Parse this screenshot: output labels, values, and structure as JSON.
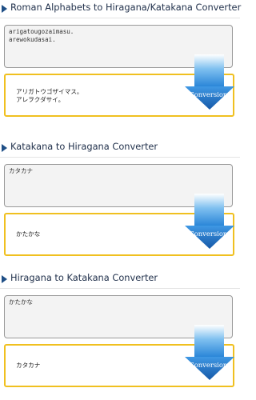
{
  "converters": [
    {
      "title": "Roman Alphabets to Hiragana/Katakana Converter",
      "input_value": "arigatougozaimasu.\narewokudasai.",
      "output_value": "アリガトウゴザイマス。\nアレヲクダサイ。",
      "button_label": "Conversion!"
    },
    {
      "title": "Katakana to Hiragana Converter",
      "input_value": "カタカナ",
      "output_value": "かたかな",
      "button_label": "Conversion!"
    },
    {
      "title": "Hiragana to Katakana Converter",
      "input_value": "かたかな",
      "output_value": "カタカナ",
      "button_label": "Conversion!"
    }
  ],
  "icons": {
    "section_marker": "triangle-right-icon",
    "convert_arrow": "down-arrow-icon"
  },
  "colors": {
    "accent_blue": "#2b78c8",
    "output_border": "#f0c020",
    "title": "#1f2f4a"
  }
}
